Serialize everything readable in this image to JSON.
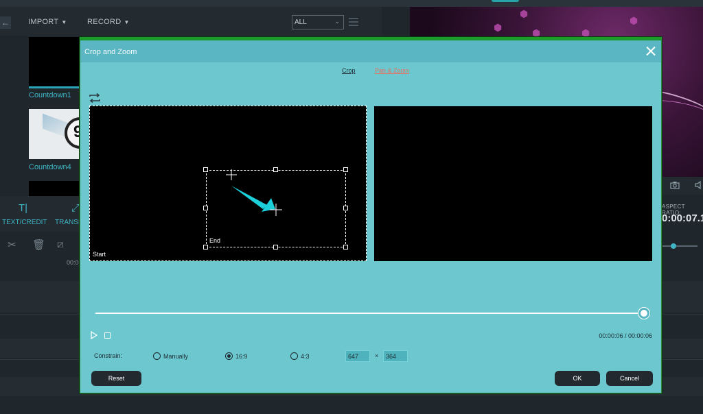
{
  "background": {
    "menu": {
      "import": "IMPORT",
      "record": "RECORD",
      "filter": "ALL"
    },
    "media": [
      {
        "label": "Countdown1"
      },
      {
        "label": "Countdown4"
      }
    ],
    "thumb_digit": "9",
    "tools": {
      "text_credit": "TEXT/CREDIT",
      "transition": "TRANSI"
    },
    "ruler_time": "00:0",
    "aspect_ratio_label": "ASPECT RATIO:",
    "preview_timecode": "0:00:07.1"
  },
  "dialog": {
    "title": "Crop and Zoom",
    "tabs": {
      "crop": "Crop",
      "pan_zoom": "Pan & Zoom"
    },
    "start_label": "Start",
    "end_label": "End",
    "time_readout": "00:00:06 / 00:00:06",
    "playhead_fraction": 1.0,
    "constrain": {
      "label": "Constrain:",
      "options": [
        "Manually",
        "16:9",
        "4:3"
      ],
      "selected": "16:9",
      "width": "647",
      "height": "364",
      "times": "×"
    },
    "buttons": {
      "reset": "Reset",
      "ok": "OK",
      "cancel": "Cancel"
    },
    "colors": {
      "dialog_bg": "#6cc7cf",
      "header_bg": "#59b6c2",
      "accent_arrow": "#1ccfd9",
      "pan_zoom_tab": "#e76f5c",
      "button_bg": "#222a30",
      "border_green": "#1c9b2a"
    },
    "icons": {
      "close": "close-icon",
      "swap": "swap-icon",
      "play": "play-icon",
      "stop": "stop-icon"
    }
  }
}
